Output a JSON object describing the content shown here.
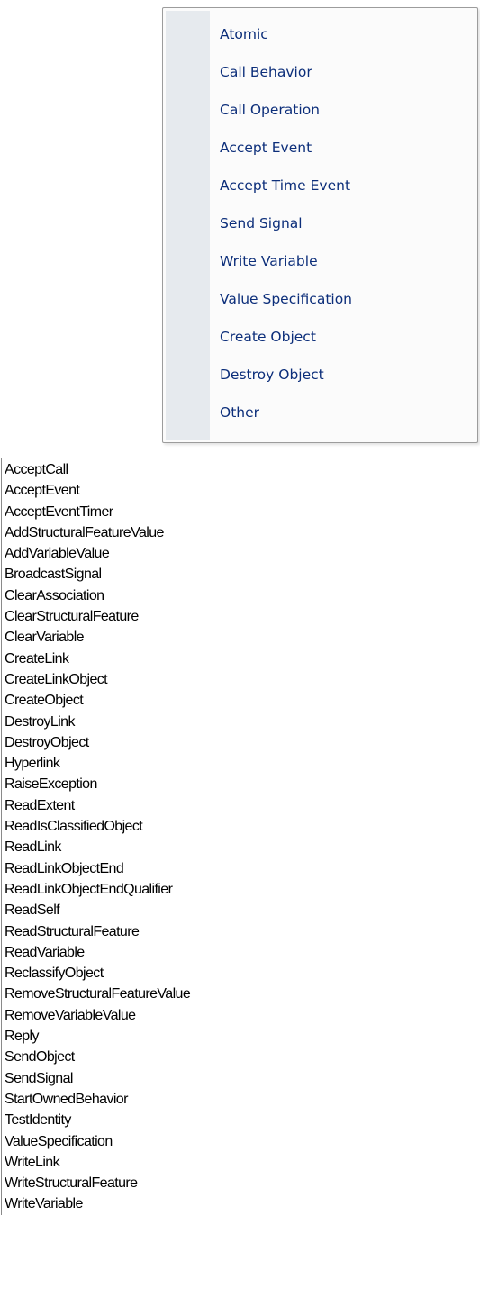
{
  "context_menu": {
    "items": [
      {
        "label": "Atomic"
      },
      {
        "label": "Call Behavior"
      },
      {
        "label": "Call Operation"
      },
      {
        "label": "Accept Event"
      },
      {
        "label": "Accept Time Event"
      },
      {
        "label": "Send Signal"
      },
      {
        "label": "Write Variable"
      },
      {
        "label": "Value Specification"
      },
      {
        "label": "Create Object"
      },
      {
        "label": "Destroy Object"
      },
      {
        "label": "Other"
      }
    ]
  },
  "action_list": {
    "items": [
      "AcceptCall",
      "AcceptEvent",
      "AcceptEventTimer",
      "AddStructuralFeatureValue",
      "AddVariableValue",
      "BroadcastSignal",
      "ClearAssociation",
      "ClearStructuralFeature",
      "ClearVariable",
      "CreateLink",
      "CreateLinkObject",
      "CreateObject",
      "DestroyLink",
      "DestroyObject",
      "Hyperlink",
      "RaiseException",
      "ReadExtent",
      "ReadIsClassifiedObject",
      "ReadLink",
      "ReadLinkObjectEnd",
      "ReadLinkObjectEndQualifier",
      "ReadSelf",
      "ReadStructuralFeature",
      "ReadVariable",
      "ReclassifyObject",
      "RemoveStructuralFeatureValue",
      "RemoveVariableValue",
      "Reply",
      "SendObject",
      "SendSignal",
      "StartOwnedBehavior",
      "TestIdentity",
      "ValueSpecification",
      "WriteLink",
      "WriteStructuralFeature",
      "WriteVariable"
    ]
  }
}
